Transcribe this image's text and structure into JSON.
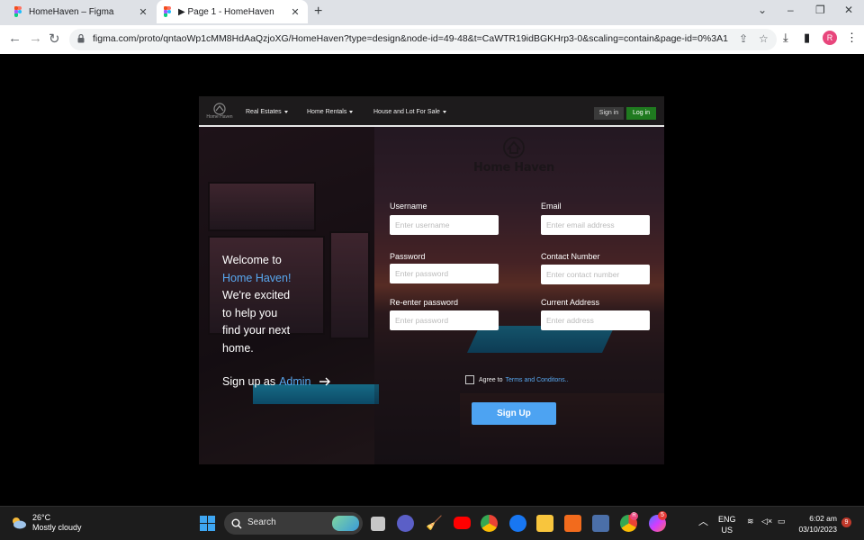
{
  "browser": {
    "tabs": [
      {
        "title": "HomeHaven – Figma"
      },
      {
        "title": "▶ Page 1 - HomeHaven"
      }
    ],
    "close_glyph": "✕",
    "new_tab_glyph": "+",
    "url": "figma.com/proto/qntaoWp1cMM8HdAaQzjoXG/HomeHaven?type=design&node-id=49-48&t=CaWTR19idBGKHrp3-0&scaling=contain&page-id=0%3A1",
    "profile_initial": "R"
  },
  "site": {
    "nav": {
      "logo_text": "Home Haven",
      "items": [
        {
          "label": "Real Estates"
        },
        {
          "label": "Home Rentals"
        },
        {
          "label": "House and Lot For Sale"
        }
      ],
      "signin_label": "Sign in",
      "login_label": "Log in"
    },
    "welcome": {
      "line1": "Welcome to",
      "brand": "Home Haven!",
      "line3": "We're excited",
      "line4": "to help you",
      "line5": "find your next",
      "line6": "home.",
      "admin_prefix": "Sign up as",
      "admin_link": "Admin"
    },
    "brand_name": "Home Haven",
    "form": {
      "username": {
        "label": "Username",
        "placeholder": "Enter username"
      },
      "email": {
        "label": "Email",
        "placeholder": "Enter email address"
      },
      "password": {
        "label": "Password",
        "placeholder": "Enter password"
      },
      "contact": {
        "label": "Contact Number",
        "placeholder": "Enter contact number"
      },
      "reenter": {
        "label": "Re-enter password",
        "placeholder": "Enter password"
      },
      "address": {
        "label": "Current Address",
        "placeholder": "Enter address"
      },
      "agree_prefix": "Agree to",
      "terms_link": "Terms and Conditons..",
      "submit_label": "Sign Up"
    }
  },
  "taskbar": {
    "temperature": "26°C",
    "weather": "Mostly cloudy",
    "search_label": "Search",
    "lang_top": "ENG",
    "lang_bottom": "US",
    "time": "6:02 am",
    "date": "03/10/2023",
    "notification_count": "9",
    "messenger_badge": "5",
    "chrome_badge": "R"
  },
  "colors": {
    "accent_blue": "#58a8f0",
    "login_green": "#1f7a1f",
    "signup_button": "#4da3f2"
  }
}
